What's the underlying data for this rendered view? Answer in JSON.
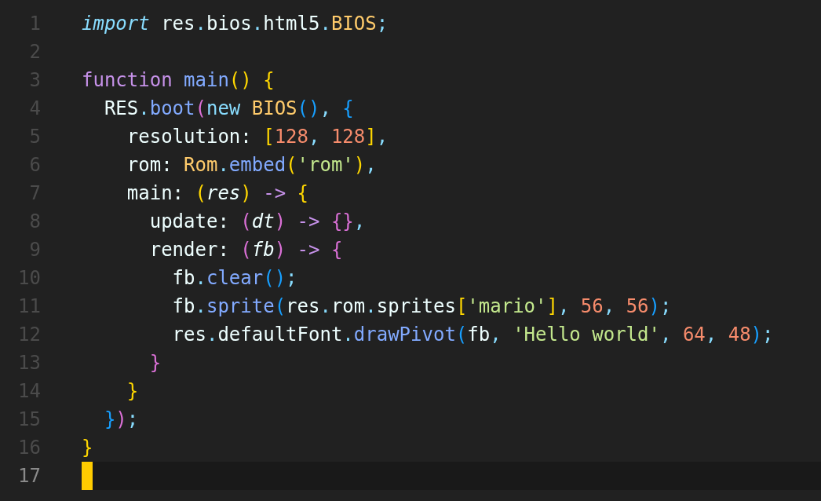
{
  "editor": {
    "lines": [
      {
        "number": "1",
        "current": false,
        "tokens": [
          {
            "kind": "keyword",
            "text": "import "
          },
          {
            "kind": "plain",
            "text": "res"
          },
          {
            "kind": "punct",
            "text": "."
          },
          {
            "kind": "plain",
            "text": "bios"
          },
          {
            "kind": "punct",
            "text": "."
          },
          {
            "kind": "plain",
            "text": "html5"
          },
          {
            "kind": "punct",
            "text": "."
          },
          {
            "kind": "class",
            "text": "BIOS"
          },
          {
            "kind": "punct",
            "text": ";"
          }
        ]
      },
      {
        "number": "2",
        "current": false
      },
      {
        "number": "3",
        "current": false,
        "tokens": [
          {
            "kind": "storage",
            "text": "function "
          },
          {
            "kind": "func",
            "text": "main"
          },
          {
            "kind": "bracket1",
            "text": "() {"
          }
        ]
      },
      {
        "number": "4",
        "current": false,
        "tokens": [
          {
            "kind": "plain",
            "text": "  RES"
          },
          {
            "kind": "punct",
            "text": "."
          },
          {
            "kind": "func",
            "text": "boot"
          },
          {
            "kind": "bracket2",
            "text": "("
          },
          {
            "kind": "operator",
            "text": "new "
          },
          {
            "kind": "class",
            "text": "BIOS"
          },
          {
            "kind": "bracket3",
            "text": "()"
          },
          {
            "kind": "punct",
            "text": ", "
          },
          {
            "kind": "bracket3",
            "text": "{"
          }
        ]
      },
      {
        "number": "5",
        "current": false,
        "tokens": [
          {
            "kind": "plain",
            "text": "    resolution: "
          },
          {
            "kind": "bracket1",
            "text": "["
          },
          {
            "kind": "number",
            "text": "128"
          },
          {
            "kind": "punct",
            "text": ", "
          },
          {
            "kind": "number",
            "text": "128"
          },
          {
            "kind": "bracket1",
            "text": "]"
          },
          {
            "kind": "punct",
            "text": ","
          }
        ]
      },
      {
        "number": "6",
        "current": false,
        "tokens": [
          {
            "kind": "plain",
            "text": "    rom: "
          },
          {
            "kind": "class",
            "text": "Rom"
          },
          {
            "kind": "punct",
            "text": "."
          },
          {
            "kind": "func",
            "text": "embed"
          },
          {
            "kind": "bracket1",
            "text": "("
          },
          {
            "kind": "string",
            "text": "'rom'"
          },
          {
            "kind": "bracket1",
            "text": ")"
          },
          {
            "kind": "punct",
            "text": ","
          }
        ]
      },
      {
        "number": "7",
        "current": false,
        "tokens": [
          {
            "kind": "plain",
            "text": "    main: "
          },
          {
            "kind": "bracket1",
            "text": "("
          },
          {
            "kind": "param",
            "text": "res"
          },
          {
            "kind": "bracket1",
            "text": ") "
          },
          {
            "kind": "storage",
            "text": "-> "
          },
          {
            "kind": "bracket1",
            "text": "{"
          }
        ]
      },
      {
        "number": "8",
        "current": false,
        "tokens": [
          {
            "kind": "plain",
            "text": "      update: "
          },
          {
            "kind": "bracket2",
            "text": "("
          },
          {
            "kind": "param",
            "text": "dt"
          },
          {
            "kind": "bracket2",
            "text": ") "
          },
          {
            "kind": "storage",
            "text": "-> "
          },
          {
            "kind": "bracket2",
            "text": "{}"
          },
          {
            "kind": "punct",
            "text": ","
          }
        ]
      },
      {
        "number": "9",
        "current": false,
        "tokens": [
          {
            "kind": "plain",
            "text": "      render: "
          },
          {
            "kind": "bracket2",
            "text": "("
          },
          {
            "kind": "param",
            "text": "fb"
          },
          {
            "kind": "bracket2",
            "text": ") "
          },
          {
            "kind": "storage",
            "text": "-> "
          },
          {
            "kind": "bracket2",
            "text": "{"
          }
        ]
      },
      {
        "number": "10",
        "current": false,
        "tokens": [
          {
            "kind": "plain",
            "text": "        fb"
          },
          {
            "kind": "punct",
            "text": "."
          },
          {
            "kind": "func",
            "text": "clear"
          },
          {
            "kind": "bracket3",
            "text": "()"
          },
          {
            "kind": "punct",
            "text": ";"
          }
        ]
      },
      {
        "number": "11",
        "current": false,
        "tokens": [
          {
            "kind": "plain",
            "text": "        fb"
          },
          {
            "kind": "punct",
            "text": "."
          },
          {
            "kind": "func",
            "text": "sprite"
          },
          {
            "kind": "bracket3",
            "text": "("
          },
          {
            "kind": "plain",
            "text": "res"
          },
          {
            "kind": "punct",
            "text": "."
          },
          {
            "kind": "plain",
            "text": "rom"
          },
          {
            "kind": "punct",
            "text": "."
          },
          {
            "kind": "plain",
            "text": "sprites"
          },
          {
            "kind": "bracket1",
            "text": "["
          },
          {
            "kind": "string",
            "text": "'mario'"
          },
          {
            "kind": "bracket1",
            "text": "]"
          },
          {
            "kind": "punct",
            "text": ", "
          },
          {
            "kind": "number",
            "text": "56"
          },
          {
            "kind": "punct",
            "text": ", "
          },
          {
            "kind": "number",
            "text": "56"
          },
          {
            "kind": "bracket3",
            "text": ")"
          },
          {
            "kind": "punct",
            "text": ";"
          }
        ]
      },
      {
        "number": "12",
        "current": false,
        "tokens": [
          {
            "kind": "plain",
            "text": "        res"
          },
          {
            "kind": "punct",
            "text": "."
          },
          {
            "kind": "plain",
            "text": "defaultFont"
          },
          {
            "kind": "punct",
            "text": "."
          },
          {
            "kind": "func",
            "text": "drawPivot"
          },
          {
            "kind": "bracket3",
            "text": "("
          },
          {
            "kind": "plain",
            "text": "fb"
          },
          {
            "kind": "punct",
            "text": ", "
          },
          {
            "kind": "string",
            "text": "'Hello world'"
          },
          {
            "kind": "punct",
            "text": ", "
          },
          {
            "kind": "number",
            "text": "64"
          },
          {
            "kind": "punct",
            "text": ", "
          },
          {
            "kind": "number",
            "text": "48"
          },
          {
            "kind": "bracket3",
            "text": ")"
          },
          {
            "kind": "punct",
            "text": ";"
          }
        ]
      },
      {
        "number": "13",
        "current": false,
        "tokens": [
          {
            "kind": "bracket2",
            "text": "      }"
          }
        ]
      },
      {
        "number": "14",
        "current": false,
        "tokens": [
          {
            "kind": "bracket1",
            "text": "    }"
          }
        ]
      },
      {
        "number": "15",
        "current": false,
        "tokens": [
          {
            "kind": "bracket3",
            "text": "  }"
          },
          {
            "kind": "bracket2",
            "text": ")"
          },
          {
            "kind": "punct",
            "text": ";"
          }
        ]
      },
      {
        "number": "16",
        "current": false,
        "tokens": [
          {
            "kind": "bracket1",
            "text": "}"
          }
        ]
      },
      {
        "number": "17",
        "current": true
      }
    ]
  }
}
